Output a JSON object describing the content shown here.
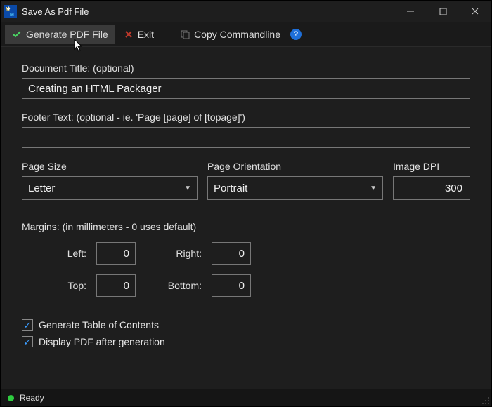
{
  "window": {
    "title": "Save As Pdf File"
  },
  "toolbar": {
    "generate": "Generate PDF File",
    "exit": "Exit",
    "copy": "Copy Commandline"
  },
  "form": {
    "doctitle_label": "Document Title: (optional)",
    "doctitle_value": "Creating an HTML Packager",
    "footer_label": "Footer Text: (optional - ie. 'Page [page] of [topage]')",
    "footer_value": "",
    "pagesize_label": "Page Size",
    "pagesize_value": "Letter",
    "orientation_label": "Page Orientation",
    "orientation_value": "Portrait",
    "dpi_label": "Image DPI",
    "dpi_value": "300",
    "margins_label": "Margins: (in millimeters - 0 uses default)",
    "margins": {
      "left_label": "Left:",
      "left_value": "0",
      "right_label": "Right:",
      "right_value": "0",
      "top_label": "Top:",
      "top_value": "0",
      "bottom_label": "Bottom:",
      "bottom_value": "0"
    },
    "toc_label": "Generate Table of Contents",
    "display_label": "Display PDF after generation"
  },
  "status": {
    "text": "Ready"
  }
}
